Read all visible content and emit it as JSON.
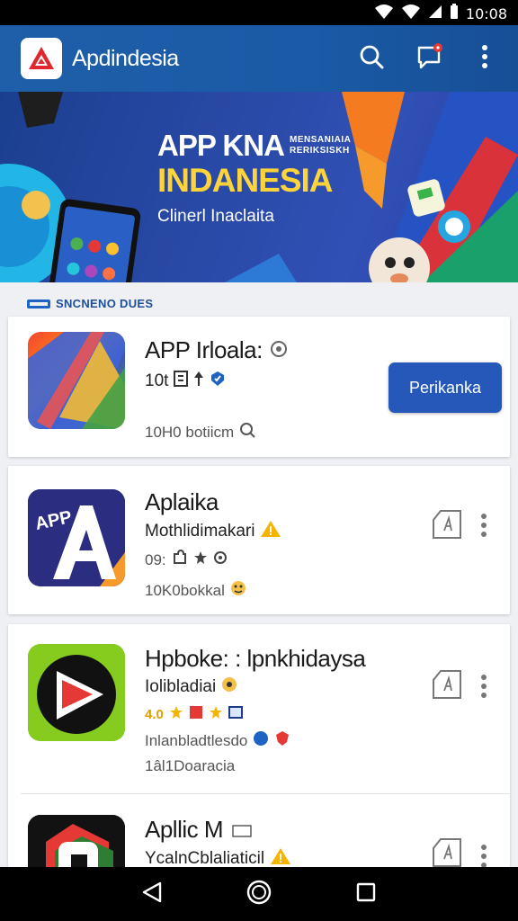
{
  "status": {
    "time": "10:08"
  },
  "app": {
    "title": "Apdindesia"
  },
  "banner": {
    "title_line1": "APP KNA",
    "title_line2": "INDANESIA",
    "subtitle": "Clinerl Inaclaita",
    "mini_text": "MENSANIAIA\nRERIKSISKH"
  },
  "section": {
    "label": "SNCNENO DUES"
  },
  "cards": [
    {
      "name": "APP Irloala:",
      "meta1": "10t",
      "meta2": "10H0 botiicm",
      "cta": "Perikanka"
    },
    {
      "name": "Aplaika",
      "sub": "Mothlidimakari",
      "meta1": "09:",
      "meta2": "10K0bokkal",
      "icon_text": "APP"
    },
    {
      "name": "Hpboke: : lpnkhidaysa",
      "sub": "Iolibladiai",
      "rating": "4.0",
      "meta1": "Inlanbladtlesdo",
      "meta2": "1âl1Doaracia"
    },
    {
      "name": "Apllic M",
      "sub": "YcalnCblaliaticil"
    }
  ],
  "colors": {
    "app_bar": "#1f5fa9",
    "accent": "#2658ba",
    "star": "#f5b400"
  }
}
